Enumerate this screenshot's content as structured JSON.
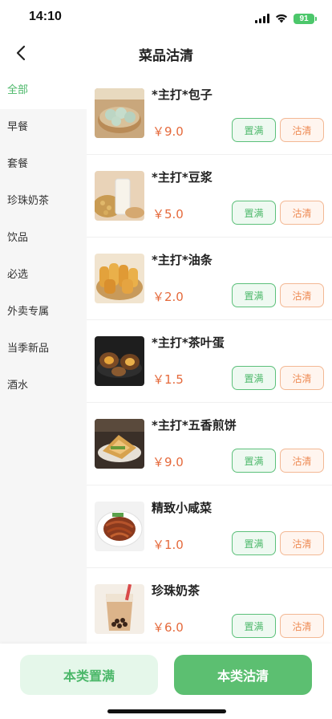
{
  "status_bar": {
    "time": "14:10",
    "battery": "91"
  },
  "header": {
    "title": "菜品沽清"
  },
  "categories": [
    {
      "label": "全部",
      "active": true
    },
    {
      "label": "早餐",
      "active": false
    },
    {
      "label": "套餐",
      "active": false
    },
    {
      "label": "珍珠奶茶",
      "active": false
    },
    {
      "label": "饮品",
      "active": false
    },
    {
      "label": "必选",
      "active": false
    },
    {
      "label": "外卖专属",
      "active": false
    },
    {
      "label": "当季新品",
      "active": false
    },
    {
      "label": "酒水",
      "active": false
    }
  ],
  "dishes": [
    {
      "name": "*主打*包子",
      "price": "￥9.0",
      "image": "steamed-buns-image"
    },
    {
      "name": "*主打*豆浆",
      "price": "￥5.0",
      "image": "soy-milk-image"
    },
    {
      "name": "*主打*油条",
      "price": "￥2.0",
      "image": "fried-dough-image"
    },
    {
      "name": "*主打*茶叶蛋",
      "price": "￥1.5",
      "image": "tea-egg-image"
    },
    {
      "name": "*主打*五香煎饼",
      "price": "￥9.0",
      "image": "pancake-image"
    },
    {
      "name": "精致小咸菜",
      "price": "￥1.0",
      "image": "pickles-image"
    },
    {
      "name": "珍珠奶茶",
      "price": "￥6.0",
      "image": "bubble-tea-image"
    }
  ],
  "actions": {
    "fill_label": "置满",
    "clear_label": "沽清",
    "fill_all_label": "本类置满",
    "clear_all_label": "本类沽清"
  },
  "colors": {
    "accent_green": "#5cbf71",
    "price_orange": "#e56a3c",
    "clear_orange": "#ee8a53"
  }
}
